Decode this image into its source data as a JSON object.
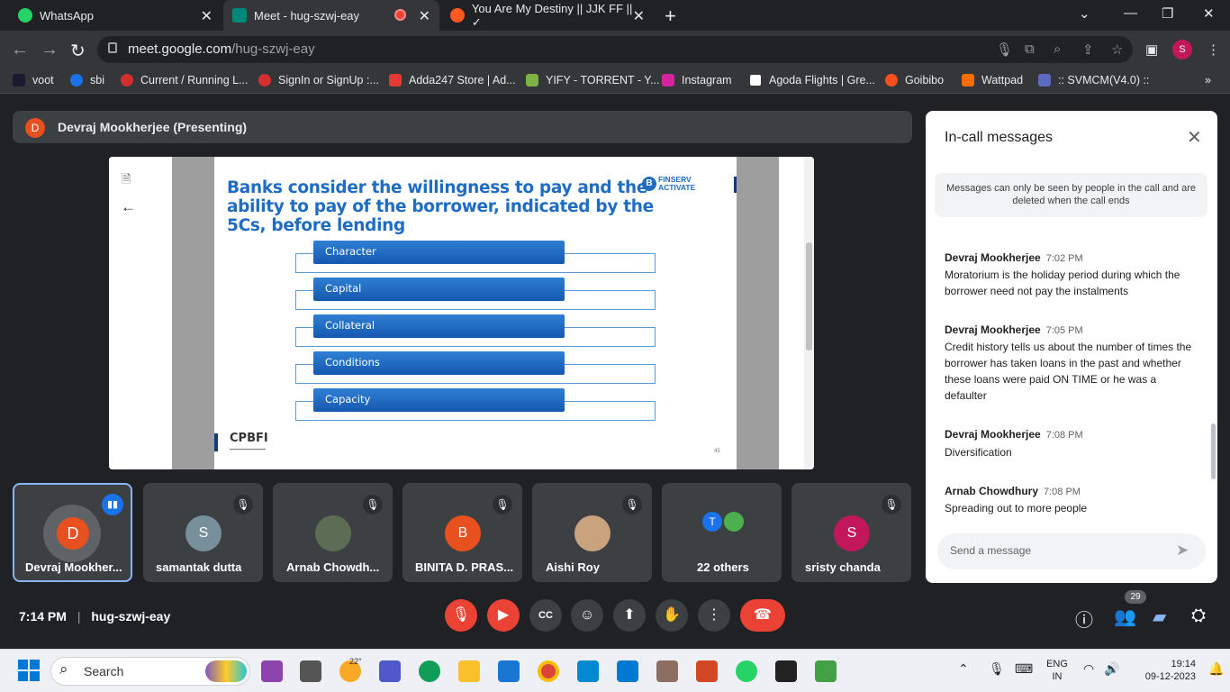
{
  "browser": {
    "tabs": [
      {
        "title": "WhatsApp",
        "color": "#25d366"
      },
      {
        "title": "Meet - hug-szwj-eay",
        "color": "#00897b"
      },
      {
        "title": "You Are My Destiny || JJK FF || ✓",
        "color": "#ff5722"
      }
    ],
    "url_host": "meet.google.com",
    "url_path": "/hug-szwj-eay",
    "profile_initial": "S",
    "bookmarks": [
      "voot",
      "sbi",
      "Current / Running L...",
      "SignIn or SignUp :...",
      "Adda247 Store | Ad...",
      "YIFY - TORRENT - Y...",
      "Instagram",
      "Agoda Flights | Gre...",
      "Goibibo",
      "Wattpad",
      ":: SVMCM(V4.0) ::"
    ]
  },
  "meet": {
    "presenter_initial": "D",
    "presenter_label": "Devraj Mookherjee (Presenting)",
    "slide": {
      "title": "Banks consider the willingness to pay and the ability to pay of the borrower, indicated by the 5Cs, before lending",
      "logo_line1": "FINSERV",
      "logo_line2": "ACTIVATE",
      "logo_mark": "B",
      "items": [
        "Character",
        "Capital",
        "Collateral",
        "Conditions",
        "Capacity"
      ],
      "footer": "CPBFI",
      "page": "45"
    },
    "participants": [
      {
        "name": "Devraj Mookher...",
        "initial": "D",
        "color": "#e8501f"
      },
      {
        "name": "samantak dutta",
        "initial": "S",
        "color": "#78909c"
      },
      {
        "name": "Arnab Chowdh...",
        "initial": "",
        "color": "#5d6d55"
      },
      {
        "name": "BINITA D. PRAS...",
        "initial": "B",
        "color": "#e8501f"
      },
      {
        "name": "Aishi Roy",
        "initial": "",
        "color": "#c9a27e"
      },
      {
        "name": "22 others",
        "initial": "T",
        "color": "#1a73e8"
      },
      {
        "name": "sristy chanda",
        "initial": "S",
        "color": "#c2185b"
      }
    ],
    "time": "7:14 PM",
    "meeting_code": "hug-szwj-eay",
    "people_count": "29"
  },
  "chat": {
    "title": "In-call messages",
    "notice": "Messages can only be seen by people in the call and are deleted when the call ends",
    "messages": [
      {
        "sender": "Devraj Mookherjee",
        "time": "7:02 PM",
        "text": "Moratorium is the holiday period during which the borrower need not pay the instalments"
      },
      {
        "sender": "Devraj Mookherjee",
        "time": "7:05 PM",
        "text": "Credit history tells us about the number of times the borrower has taken loans in the past and whether these loans were paid ON TIME or he was a defaulter"
      },
      {
        "sender": "Devraj Mookherjee",
        "time": "7:08 PM",
        "text": "Diversification"
      },
      {
        "sender": "Arnab Chowdhury",
        "time": "7:08 PM",
        "text": "Spreading out to more people"
      }
    ],
    "input_placeholder": "Send a message"
  },
  "taskbar": {
    "search_label": "Search",
    "weather_temp": "22°",
    "lang_line1": "ENG",
    "lang_line2": "IN",
    "clock_time": "19:14",
    "clock_date": "09-12-2023"
  }
}
